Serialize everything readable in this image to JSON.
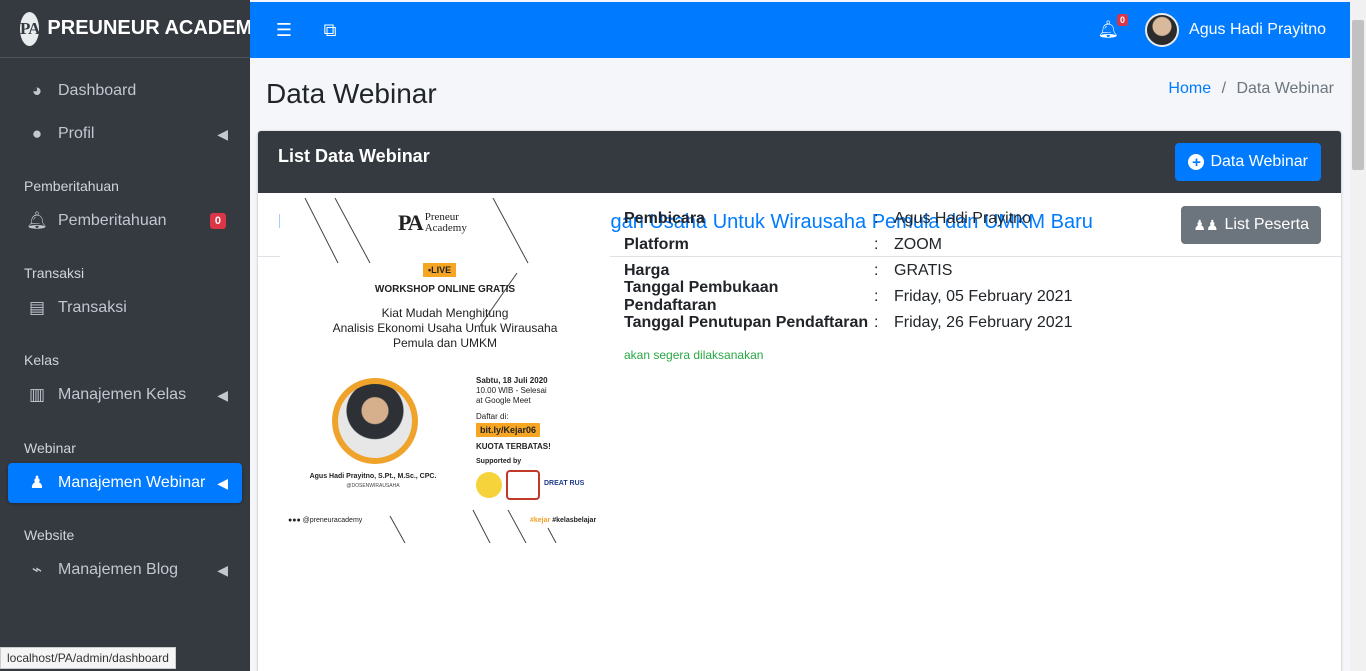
{
  "brand": {
    "logo": "PA",
    "name": "PREUNEUR ACADEMY"
  },
  "sidebar": {
    "items": [
      {
        "label": "Dashboard",
        "icon": "tachometer-icon"
      },
      {
        "label": "Profil",
        "icon": "user-icon"
      },
      {
        "header": "Pemberitahuan"
      },
      {
        "label": "Pemberitahuan",
        "icon": "bell-icon",
        "badge": "0"
      },
      {
        "header": "Transaksi"
      },
      {
        "label": "Transaksi",
        "icon": "receipt-icon"
      },
      {
        "header": "Kelas"
      },
      {
        "label": "Manajemen Kelas",
        "icon": "book-icon"
      },
      {
        "header": "Webinar"
      },
      {
        "label": "Manajemen Webinar",
        "icon": "users-icon"
      },
      {
        "header": "Website"
      },
      {
        "label": "Manajemen Blog",
        "icon": "blog-icon"
      }
    ]
  },
  "topbar": {
    "notif_count": "0",
    "user_name": "Agus Hadi Prayitno"
  },
  "page": {
    "title": "Data Webinar",
    "breadcrumb_home": "Home",
    "breadcrumb_sep": "/",
    "breadcrumb_current": "Data Webinar"
  },
  "card": {
    "title": "List Data Webinar",
    "add_button": "Data Webinar",
    "webinar_title": "Kiat Mudah Membuat Laporan Keuangan Usaha Untuk Wirausaha Pemula dan UMKM Baru",
    "participants_button": "List Peserta"
  },
  "poster": {
    "logo_pa": "PA",
    "logo_line1": "Preneur",
    "logo_line2": "Academy",
    "live": "•LIVE",
    "workshop": "WORKSHOP ONLINE GRATIS",
    "title_line1": "Kiat Mudah Menghitung",
    "title_line2": "Analisis Ekonomi Usaha Untuk Wirausaha",
    "title_line3": "Pemula dan UMKM",
    "date": "Sabtu, 18 Juli 2020",
    "time": "10.00 WIB - Selesai",
    "place": "at Google Meet",
    "daftar": "Daftar di:",
    "link": "bit.ly/Kejar06",
    "kuota": "KUOTA TERBATAS!",
    "supported": "Supported by",
    "sponsor": "DREAT RUS",
    "speaker": "Agus Hadi Prayitno, S.Pt., M.Sc., CPC.",
    "speaker_handle": "@DOSENWIRAUSAHA",
    "social": "@preneuracademy",
    "tag1": "#kejar",
    "tag2": " #kelasbelajar"
  },
  "details": [
    {
      "label": "Pembicara",
      "value": "Agus Hadi Prayitno"
    },
    {
      "label": "Platform",
      "value": "ZOOM"
    },
    {
      "label": "Harga",
      "value": "GRATIS"
    },
    {
      "label": "Tanggal Pembukaan Pendaftaran",
      "value": "Friday, 05 February 2021"
    },
    {
      "label": "Tanggal Penutupan Pendaftaran",
      "value": "Friday, 26 February 2021"
    }
  ],
  "status_text": "akan segera dilaksanakan",
  "statusbar_url": "localhost/PA/admin/dashboard",
  "colors": {
    "primary": "#007bff",
    "sidebar": "#343a40",
    "danger": "#dc3545",
    "success": "#28a745",
    "secondary": "#6c757d"
  }
}
